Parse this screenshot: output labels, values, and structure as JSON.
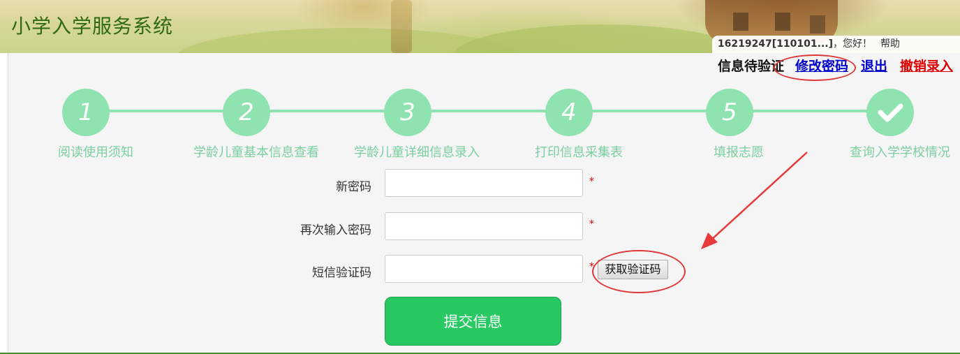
{
  "app": {
    "title": "小学入学服务系统"
  },
  "user_bar": {
    "user_id": "16219247[110101...]",
    "greeting": "，您好！",
    "help": "帮助"
  },
  "status_bar": {
    "status": "信息待验证",
    "change_password": "修改密码",
    "logout": "退出",
    "cancel_entry": "撤销录入"
  },
  "steps": [
    {
      "number": "1",
      "label": "阅读使用须知"
    },
    {
      "number": "2",
      "label": "学龄儿童基本信息查看"
    },
    {
      "number": "3",
      "label": "学龄儿童详细信息录入"
    },
    {
      "number": "4",
      "label": "打印信息采集表"
    },
    {
      "number": "5",
      "label": "填报志愿"
    },
    {
      "number": "",
      "label": "查询入学学校情况"
    }
  ],
  "form": {
    "new_password_label": "新密码",
    "new_password_value": "",
    "confirm_password_label": "再次输入密码",
    "confirm_password_value": "",
    "sms_code_label": "短信验证码",
    "sms_code_value": "",
    "required_mark": "*",
    "get_code_button": "获取验证码",
    "submit_button": "提交信息"
  },
  "colors": {
    "step_accent": "#8fe3b0",
    "submit_green": "#28c963",
    "title_green": "#2e6a12",
    "annotation_red": "#e03838",
    "link_blue": "#0000cc",
    "cancel_red": "#e00000"
  }
}
